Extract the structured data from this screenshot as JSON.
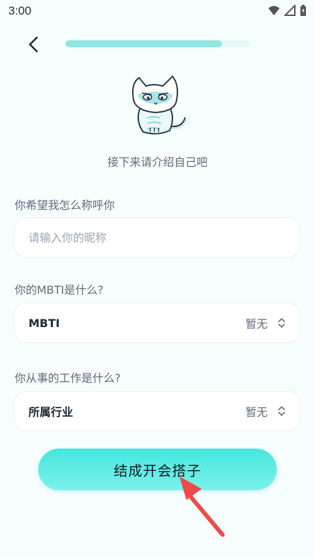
{
  "status_bar": {
    "time": "3:00",
    "icons": [
      "wifi-icon",
      "signal-icon",
      "battery-charging-icon"
    ]
  },
  "header": {
    "back_icon": "chevron-left-icon",
    "progress_fraction": 0.85
  },
  "intro": {
    "mascot": "cat-mascot-icon",
    "text": "接下来请介绍自己吧"
  },
  "nickname": {
    "label": "你希望我怎么称呼你",
    "placeholder": "请输入你的昵称",
    "value": ""
  },
  "mbti": {
    "label": "你的MBTI是什么?",
    "field_label": "MBTI",
    "value": "暂无",
    "icon": "chevron-up-down-icon"
  },
  "industry": {
    "label": "你从事的工作是什么?",
    "field_label": "所属行业",
    "value": "暂无",
    "icon": "chevron-up-down-icon"
  },
  "cta": {
    "label": "结成开会搭子"
  },
  "colors": {
    "background": "#f6fdfd",
    "accent": "#46e6dd",
    "arrow": "#ef4a48"
  }
}
